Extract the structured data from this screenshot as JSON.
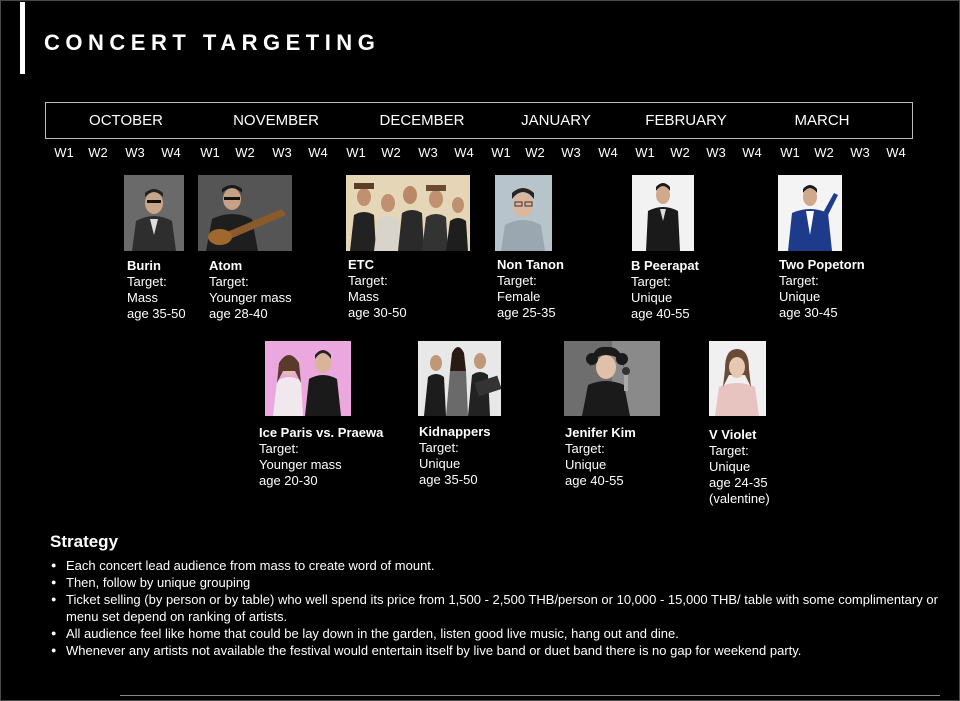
{
  "title": "CONCERT TARGETING",
  "months": [
    "OCTOBER",
    "NOVEMBER",
    "DECEMBER",
    "JANUARY",
    "FEBRUARY",
    "MARCH"
  ],
  "weeks": [
    "W1",
    "W2",
    "W3",
    "W4",
    "W1",
    "W2",
    "W3",
    "W4",
    "W1",
    "W2",
    "W3",
    "W4",
    "W1",
    "W2",
    "W3",
    "W4",
    "W1",
    "W2",
    "W3",
    "W4",
    "W1",
    "W2",
    "W3",
    "W4"
  ],
  "artists": [
    {
      "name": "Burin",
      "target": "Target:",
      "group": "Mass",
      "age": "age 35-50"
    },
    {
      "name": "Atom",
      "target": "Target:",
      "group": "Younger mass",
      "age": "age 28-40"
    },
    {
      "name": "ETC",
      "target": "Target:",
      "group": "Mass",
      "age": "age 30-50"
    },
    {
      "name": "Non Tanon",
      "target": "Target:",
      "group": "Female",
      "age": "age 25-35"
    },
    {
      "name": "B Peerapat",
      "target": "Target:",
      "group": "Unique",
      "age": "age 40-55"
    },
    {
      "name": "Two Popetorn",
      "target": "Target:",
      "group": "Unique",
      "age": "age 30-45"
    },
    {
      "name": "Ice Paris vs. Praewa",
      "target": "Target:",
      "group": "Younger mass",
      "age": "age 20-30"
    },
    {
      "name": "Kidnappers",
      "target": "Target:",
      "group": "Unique",
      "age": "age 35-50"
    },
    {
      "name": "Jenifer Kim",
      "target": "Target:",
      "group": "Unique",
      "age": "age 40-55"
    },
    {
      "name": "V Violet",
      "target": "Target:",
      "group": "Unique",
      "age": "age 24-35",
      "note": "(valentine)"
    }
  ],
  "strategy": {
    "title": "Strategy",
    "items": [
      "Each concert lead audience from mass to create word of mount.",
      "Then, follow by unique grouping",
      "Ticket selling (by person or by table) who well spend its price from 1,500 - 2,500 THB/person or 10,000 - 15,000 THB/ table with some complimentary or menu set depend on ranking of artists.",
      "All audience feel like home that could be lay down in the garden, listen good live music, hang out and dine.",
      "Whenever any artists not available the festival would entertain itself by live band or duet band there is no gap for weekend party."
    ]
  }
}
